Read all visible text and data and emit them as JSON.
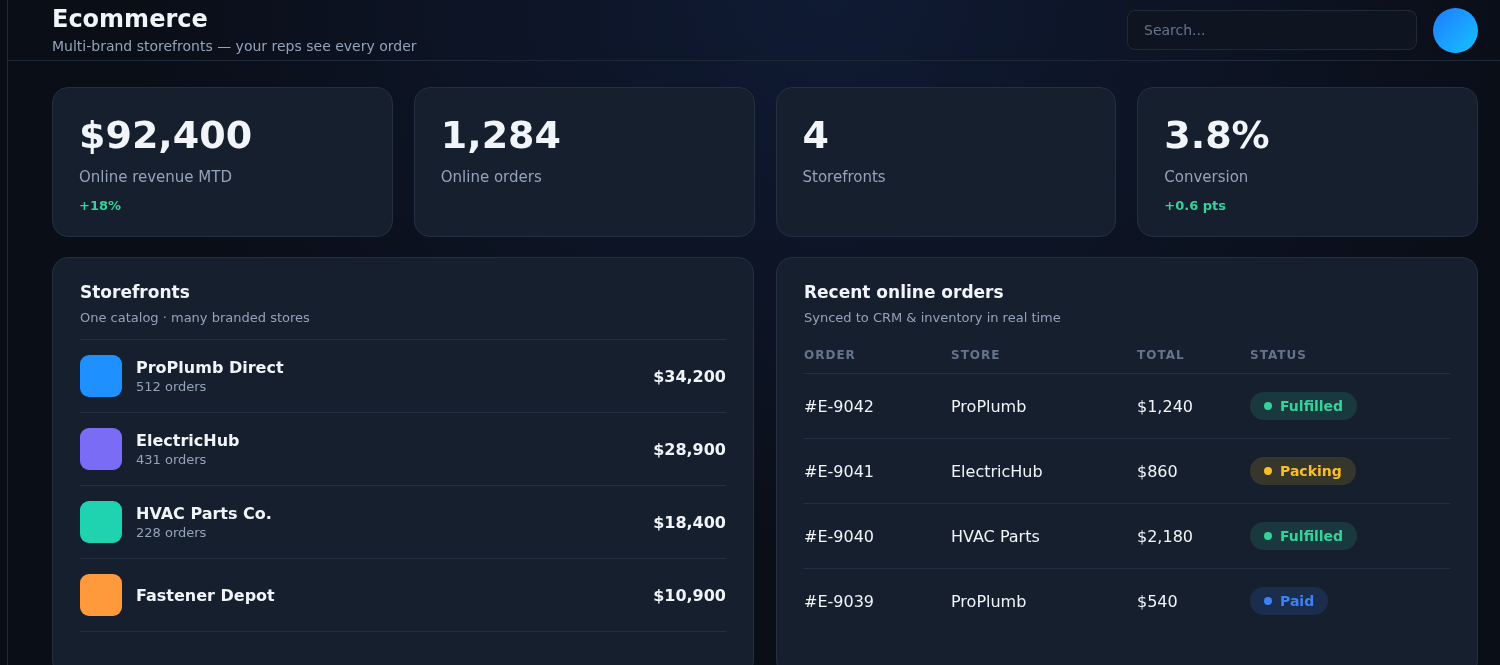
{
  "header": {
    "title": "Ecommerce",
    "subtitle": "Multi-brand storefronts — your reps see every order",
    "search": {
      "placeholder": "Search..."
    }
  },
  "stats": [
    {
      "value": "$92,400",
      "label": "Online revenue MTD",
      "delta": "+18%"
    },
    {
      "value": "1,284",
      "label": "Online orders"
    },
    {
      "value": "4",
      "label": "Storefronts"
    },
    {
      "value": "3.8%",
      "label": "Conversion",
      "delta": "+0.6 pts"
    }
  ],
  "storefronts": {
    "title": "Storefronts",
    "subtitle": "One catalog · many branded stores",
    "items": [
      {
        "name": "ProPlumb Direct",
        "orders": "512 orders",
        "revenue": "$34,200",
        "color": "#1e90ff"
      },
      {
        "name": "ElectricHub",
        "orders": "431 orders",
        "revenue": "$28,900",
        "color": "#7b6cf6"
      },
      {
        "name": "HVAC Parts Co.",
        "orders": "228 orders",
        "revenue": "$18,400",
        "color": "#20d3b0"
      },
      {
        "name": "Fastener Depot",
        "revenue": "$10,900",
        "color": "#ff9a3c"
      }
    ]
  },
  "orders": {
    "title": "Recent online orders",
    "subtitle": "Synced to CRM & inventory in real time",
    "columns": [
      "ORDER",
      "STORE",
      "TOTAL",
      "STATUS"
    ],
    "rows": [
      {
        "order": "#E-9042",
        "store": "ProPlumb",
        "total": "$1,240",
        "status": "Fulfilled",
        "color": "#34d399"
      },
      {
        "order": "#E-9041",
        "store": "ElectricHub",
        "total": "$860",
        "status": "Packing",
        "color": "#fbbf24"
      },
      {
        "order": "#E-9040",
        "store": "HVAC Parts",
        "total": "$2,180",
        "status": "Fulfilled",
        "color": "#34d399"
      },
      {
        "order": "#E-9039",
        "store": "ProPlumb",
        "total": "$540",
        "status": "Paid",
        "color": "#3b82f6"
      }
    ]
  }
}
